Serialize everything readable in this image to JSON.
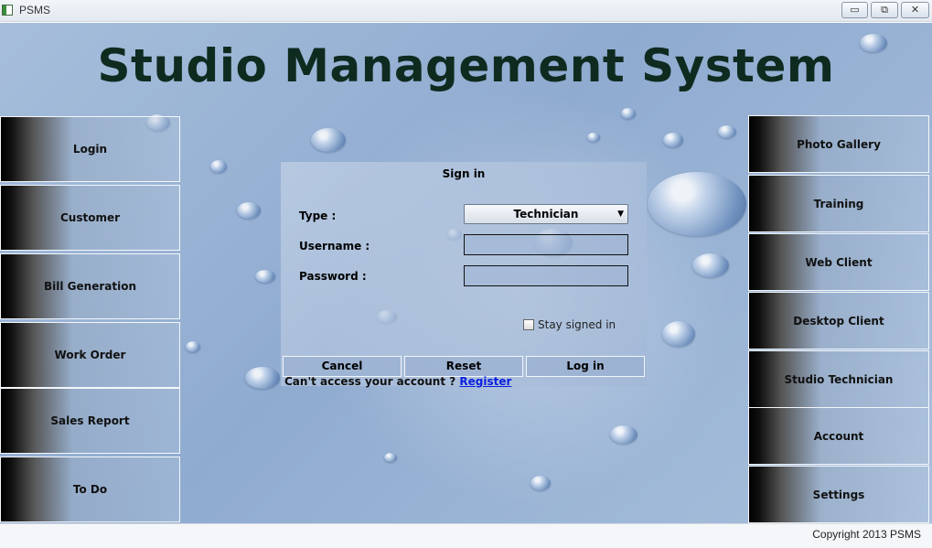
{
  "window": {
    "title": "PSMS",
    "minimize_glyph": "▭",
    "restore_glyph": "⧉",
    "close_glyph": "✕"
  },
  "header": {
    "title": "Studio Management System"
  },
  "left_nav": {
    "items": [
      {
        "label": "Login"
      },
      {
        "label": "Customer"
      },
      {
        "label": "Bill Generation"
      },
      {
        "label": "Work Order"
      },
      {
        "label": "Sales Report"
      },
      {
        "label": "To Do"
      }
    ]
  },
  "right_nav": {
    "items": [
      {
        "label": "Photo Gallery"
      },
      {
        "label": "Training"
      },
      {
        "label": "Web Client"
      },
      {
        "label": "Desktop Client"
      },
      {
        "label": "Studio Technician"
      },
      {
        "label": "Account"
      },
      {
        "label": "Settings"
      }
    ]
  },
  "signin": {
    "title": "Sign in",
    "type_label": "Type :",
    "type_value": "Technician",
    "username_label": "Username :",
    "username_value": "",
    "password_label": "Password :",
    "password_value": "",
    "stay_signed_in": "Stay signed in",
    "cancel": "Cancel",
    "reset": "Reset",
    "login": "Log in",
    "access_text": "Can't access your account ? ",
    "register_link": "Register"
  },
  "status": {
    "copyright": "Copyright 2013 PSMS"
  },
  "icons": {
    "dropdown": "chevron-down-icon"
  }
}
